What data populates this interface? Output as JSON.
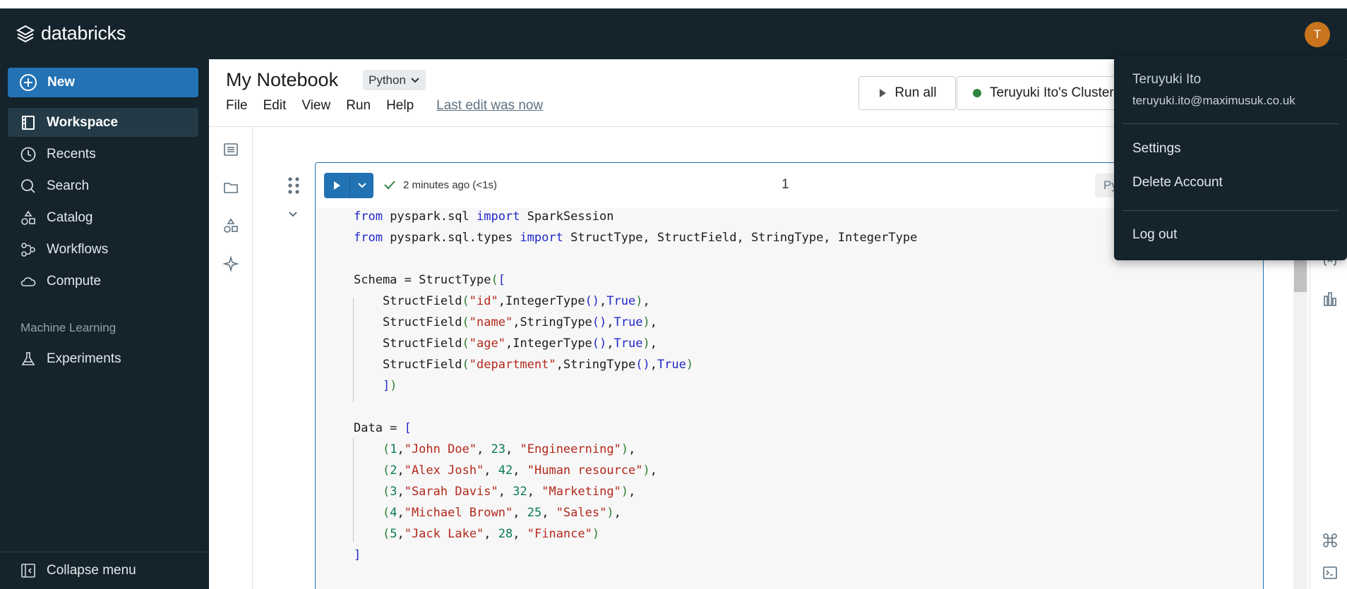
{
  "app": {
    "brand": "databricks",
    "avatar_initial": "T"
  },
  "sidebar": {
    "new_label": "New",
    "items": [
      {
        "label": "Workspace",
        "icon": "workspace-icon",
        "active": true
      },
      {
        "label": "Recents",
        "icon": "clock-icon"
      },
      {
        "label": "Search",
        "icon": "search-icon"
      },
      {
        "label": "Catalog",
        "icon": "catalog-icon"
      },
      {
        "label": "Workflows",
        "icon": "workflows-icon"
      },
      {
        "label": "Compute",
        "icon": "cloud-icon"
      }
    ],
    "section_label": "Machine Learning",
    "ml_items": [
      {
        "label": "Experiments",
        "icon": "flask-icon"
      }
    ],
    "collapse_label": "Collapse menu"
  },
  "notebook": {
    "title": "My Notebook",
    "language": "Python",
    "menu": [
      "File",
      "Edit",
      "View",
      "Run",
      "Help"
    ],
    "last_edit": "Last edit was now",
    "run_all": "Run all",
    "cluster": "Teruyuki Ito's Cluster"
  },
  "cell": {
    "status": "2 minutes ago (<1s)",
    "number": "1",
    "lang": "Python"
  },
  "user_menu": {
    "name": "Teruyuki Ito",
    "email": "teruyuki.ito@maximusuk.co.uk",
    "settings": "Settings",
    "delete": "Delete Account",
    "logout": "Log out"
  },
  "colors": {
    "topbar": "#14232c",
    "accent": "#2272b4",
    "avatar": "#c8741c"
  }
}
